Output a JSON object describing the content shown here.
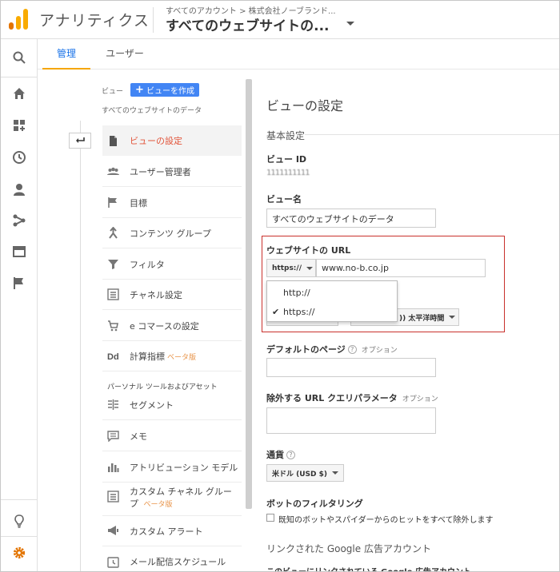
{
  "header": {
    "app_title": "アナリティクス",
    "breadcrumb": "すべてのアカウント > 株式会社ノーブランド...",
    "view_name": "すべてのウェブサイトの...",
    "brand_colors": [
      "#f9ab00",
      "#e37400"
    ]
  },
  "rail": {
    "items": [
      "search-icon",
      "home-icon",
      "dashboard-icon",
      "clock-icon",
      "person-icon",
      "flow-icon",
      "behavior-icon",
      "flag-icon",
      "lightbulb-icon",
      "gear-icon"
    ]
  },
  "tabs": [
    {
      "label": "管理"
    },
    {
      "label": "ユーザー"
    }
  ],
  "nav": {
    "header_label": "ビュー",
    "create_button": "ビューを作成",
    "subtitle": "すべてのウェブサイトのデータ",
    "items": [
      {
        "label": "ビューの設定",
        "icon": "document-icon"
      },
      {
        "label": "ユーザー管理者",
        "icon": "users-icon"
      },
      {
        "label": "目標",
        "icon": "flag-icon"
      },
      {
        "label": "コンテンツ グループ",
        "icon": "content-group-icon"
      },
      {
        "label": "フィルタ",
        "icon": "filter-icon"
      },
      {
        "label": "チャネル設定",
        "icon": "channel-icon"
      },
      {
        "label": "e コマースの設定",
        "icon": "cart-icon"
      },
      {
        "label": "計算指標",
        "icon": "dd-icon",
        "badge": "ベータ版"
      }
    ],
    "section_label": "パーソナル ツールおよびアセット",
    "tools": [
      {
        "label": "セグメント",
        "icon": "segment-icon"
      },
      {
        "label": "メモ",
        "icon": "memo-icon"
      },
      {
        "label": "アトリビューション モデル",
        "icon": "bar-chart-icon"
      },
      {
        "label": "カスタム チャネル グループ",
        "icon": "channel-icon",
        "badge": "ベータ版"
      },
      {
        "label": "カスタム アラート",
        "icon": "megaphone-icon"
      },
      {
        "label": "メール配信スケジュール",
        "icon": "alarm-icon"
      }
    ],
    "selected_color": "#e2543a",
    "badge_color": "#e8944a"
  },
  "content": {
    "page_title": "ビューの設定",
    "section_basic": "基本設定",
    "view_id_label": "ビュー ID",
    "view_id_value": "1111111111",
    "view_name_label": "ビュー名",
    "view_name_value": "すべてのウェブサイトのデータ",
    "url_label": "ウェブサイトの URL",
    "protocol_value": "https://",
    "url_value": "www.no-b.co.jp",
    "protocol_options": [
      {
        "label": "http://",
        "checked": false
      },
      {
        "label": "https://",
        "checked": true
      }
    ],
    "timezone_value": ")) 太平洋時間",
    "default_page_label": "デフォルトのページ",
    "default_page_optional": "オプション",
    "exclude_params_label": "除外する URL クエリパラメータ",
    "exclude_params_optional": "オプション",
    "currency_label": "通貨",
    "currency_value": "米ドル (USD $)",
    "bot_filter_label": "ボットのフィルタリング",
    "bot_filter_checkbox": "既知のボットやスパイダーからのヒットをすべて除外します",
    "linked_ads_title": "リンクされた Google 広告アカウント",
    "linked_ads_line": "このビューにリンクされている Google 広告アカウント",
    "highlight_color": "#c9302c",
    "tab_accent_color": "#f6a600",
    "button_color": "#4285f4"
  }
}
